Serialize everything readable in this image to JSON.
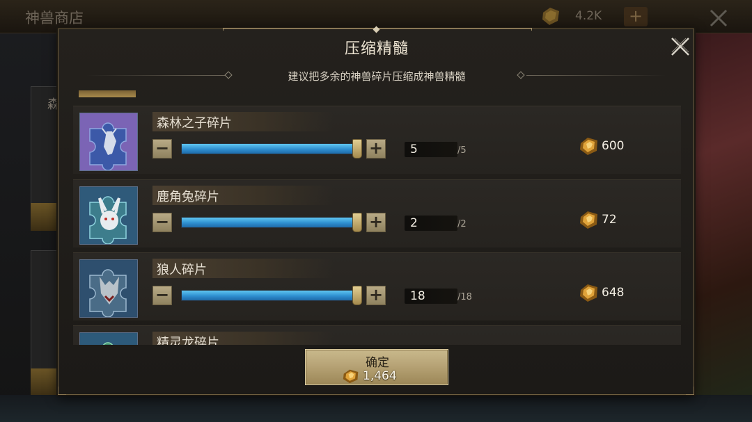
{
  "background": {
    "shop_title": "神兽商店",
    "currency_value": "4.2K",
    "currency_icon": "amber-essence-icon",
    "side_card_label": "森",
    "plus_label": "+"
  },
  "dialog": {
    "title": "压缩精髓",
    "subtitle": "建议把多余的神兽碎片压缩成神兽精髓",
    "close_icon": "close-x-icon"
  },
  "fragments": [
    {
      "name": "森林之子碎片",
      "icon": "forest-child-fragment-icon",
      "quantity": "5",
      "max_label": "/5",
      "fill_fraction": 1.0,
      "reward": "600"
    },
    {
      "name": "鹿角兔碎片",
      "icon": "antler-rabbit-fragment-icon",
      "quantity": "2",
      "max_label": "/2",
      "fill_fraction": 1.0,
      "reward": "72"
    },
    {
      "name": "狼人碎片",
      "icon": "werewolf-fragment-icon",
      "quantity": "18",
      "max_label": "/18",
      "fill_fraction": 1.0,
      "reward": "648"
    },
    {
      "name": "精灵龙碎片",
      "icon": "fairy-dragon-fragment-icon"
    }
  ],
  "controls": {
    "minus_label": "−",
    "plus_label": "+"
  },
  "confirm": {
    "label": "确定",
    "cost": "1,464",
    "cost_icon": "amber-essence-icon"
  },
  "colors": {
    "accent_gold": "#b7a376",
    "slider_blue": "#2f8fd0",
    "panel": "#24211d"
  }
}
